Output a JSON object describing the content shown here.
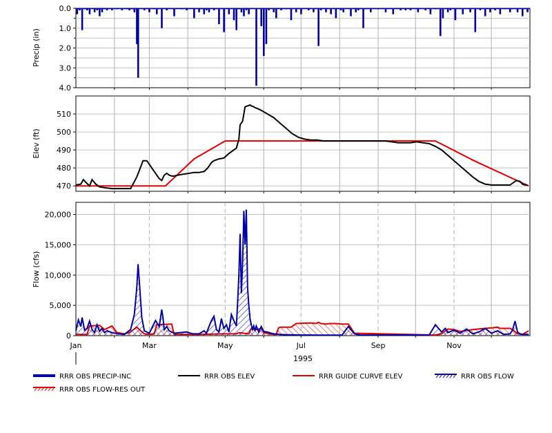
{
  "colors": {
    "precip": "#0000a8",
    "elev": "#000000",
    "guide": "#e00000",
    "flow": "#0000a8",
    "res_out": "#e00000",
    "grid": "#c0c0c0",
    "month_grid": "#b0b0b0"
  },
  "x_axis": {
    "month_labels": [
      "Jan",
      "Mar",
      "May",
      "Jul",
      "Sep",
      "Nov"
    ],
    "year_label": "1995"
  },
  "legend": [
    {
      "key": "precip",
      "label": "RRR OBS PRECIP-INC",
      "style": "thick-line"
    },
    {
      "key": "elev",
      "label": "RRR OBS ELEV",
      "style": "line"
    },
    {
      "key": "guide",
      "label": "RRR GUIDE CURVE ELEV",
      "style": "line"
    },
    {
      "key": "flow",
      "label": "RRR OBS FLOW",
      "style": "hatch"
    },
    {
      "key": "res_out",
      "label": "RRR OBS FLOW-RES OUT",
      "style": "hatch"
    }
  ],
  "chart_data": [
    {
      "type": "bar",
      "inverted_y": true,
      "ylabel": "Precip (in)",
      "ylim": [
        0,
        4
      ],
      "yticks": [
        0,
        1,
        2,
        3,
        4
      ],
      "ytick_labels": [
        "0.0",
        "1.0",
        "2.0",
        "3.0",
        "4.0"
      ],
      "grid": true,
      "x_unit": "day-of-year 1995",
      "series": [
        {
          "name": "RRR OBS PRECIP-INC",
          "x": [
            2,
            4,
            6,
            8,
            10,
            12,
            16,
            18,
            20,
            22,
            24,
            26,
            30,
            34,
            38,
            42,
            44,
            46,
            48,
            50,
            51,
            56,
            60,
            64,
            66,
            70,
            74,
            80,
            86,
            90,
            96,
            100,
            102,
            104,
            106,
            108,
            112,
            116,
            120,
            124,
            128,
            130,
            132,
            134,
            136,
            138,
            140,
            146,
            150,
            152,
            154,
            156,
            160,
            162,
            166,
            170,
            174,
            178,
            182,
            188,
            192,
            196,
            198,
            202,
            206,
            210,
            214,
            216,
            222,
            226,
            228,
            232,
            234,
            238,
            244,
            250,
            256,
            262,
            266,
            270,
            276,
            282,
            286,
            290,
            294,
            296,
            300,
            302,
            306,
            312,
            318,
            322,
            326,
            330,
            334,
            338,
            342,
            346,
            350,
            352,
            356,
            360,
            364
          ],
          "values": [
            0.3,
            0.1,
            1.1,
            0.05,
            0.1,
            0.3,
            0.2,
            0.1,
            0.4,
            0.2,
            0.05,
            0.1,
            0.1,
            0.05,
            0.1,
            0.05,
            0.1,
            0.05,
            0.2,
            1.8,
            3.5,
            0.1,
            0.2,
            0.05,
            0.3,
            1.0,
            0.1,
            0.4,
            0.05,
            0.1,
            0.5,
            0.2,
            0.05,
            0.3,
            0.1,
            0.2,
            0.1,
            0.8,
            1.2,
            0.3,
            0.6,
            1.1,
            0.05,
            0.2,
            0.4,
            0.1,
            0.3,
            3.9,
            0.9,
            2.4,
            1.8,
            0.1,
            0.2,
            0.5,
            0.1,
            0.05,
            0.6,
            0.2,
            0.3,
            0.1,
            0.2,
            1.9,
            0.1,
            0.2,
            0.3,
            0.5,
            0.1,
            0.2,
            0.4,
            0.2,
            0.1,
            1.0,
            0.05,
            0.2,
            0.05,
            0.2,
            0.3,
            0.1,
            0.1,
            0.1,
            0.2,
            0.1,
            0.3,
            0.05,
            1.4,
            0.5,
            0.2,
            0.1,
            0.6,
            0.3,
            0.2,
            1.2,
            0.1,
            0.4,
            0.2,
            0.1,
            0.3,
            0.05,
            0.2,
            0.05,
            0.2,
            0.4,
            0.2
          ]
        }
      ]
    },
    {
      "type": "line",
      "ylabel": "Elev (ft)",
      "ylim": [
        467,
        520
      ],
      "yticks": [
        470,
        480,
        490,
        500,
        510
      ],
      "grid": true,
      "x_unit": "day-of-year 1995",
      "series": [
        {
          "name": "RRR OBS ELEV",
          "x": [
            1,
            5,
            7,
            9,
            12,
            14,
            17,
            20,
            24,
            30,
            35,
            40,
            45,
            50,
            55,
            58,
            60,
            62,
            64,
            66,
            68,
            70,
            72,
            74,
            76,
            78,
            80,
            83,
            87,
            92,
            96,
            100,
            104,
            107,
            110,
            112,
            116,
            120,
            124,
            128,
            130,
            132,
            133,
            135,
            137,
            139,
            141,
            142,
            144,
            145,
            147,
            150,
            155,
            160,
            165,
            170,
            175,
            180,
            185,
            190,
            195,
            200,
            210,
            220,
            230,
            240,
            250,
            255,
            260,
            265,
            270,
            275,
            280,
            285,
            290,
            295,
            300,
            305,
            310,
            315,
            320,
            325,
            330,
            335,
            340,
            345,
            350,
            353,
            355,
            358,
            360,
            362,
            364
          ],
          "values": [
            470.5,
            471,
            473.5,
            472,
            470,
            473.5,
            471,
            469.5,
            469,
            468.5,
            468.5,
            468.5,
            468.5,
            475,
            484,
            484,
            482,
            480,
            478,
            476,
            474,
            473,
            476,
            477,
            476,
            475.5,
            475.5,
            476,
            476.5,
            477,
            477.5,
            477.5,
            478,
            480,
            483,
            484,
            485,
            485.5,
            488,
            490,
            491,
            496,
            504,
            506,
            514,
            514.5,
            515,
            514.5,
            514,
            513.5,
            513,
            512,
            510,
            508,
            505,
            502,
            499,
            497,
            496,
            495.5,
            495.5,
            495,
            495,
            495,
            495,
            495,
            495,
            494.5,
            494,
            494,
            494,
            494.5,
            494,
            493.5,
            492,
            490,
            487,
            484,
            481,
            478,
            475,
            472.5,
            471,
            470.5,
            470.5,
            470.5,
            470.5,
            472,
            473,
            472.5,
            471,
            470.5,
            470.5
          ]
        },
        {
          "name": "RRR GUIDE CURVE ELEV",
          "x": [
            1,
            73,
            96,
            121,
            290,
            321,
            365
          ],
          "values": [
            470,
            470,
            485,
            495,
            495,
            484,
            470
          ]
        }
      ]
    },
    {
      "type": "area",
      "ylabel": "Flow (cfs)",
      "ylim": [
        0,
        22000
      ],
      "yticks": [
        0,
        5000,
        10000,
        15000,
        20000
      ],
      "ytick_labels": [
        "0",
        "5,000",
        "10,000",
        "15,000",
        "20,000"
      ],
      "grid": true,
      "x_unit": "day-of-year 1995",
      "series": [
        {
          "name": "RRR OBS FLOW",
          "x": [
            1,
            3,
            5,
            6,
            8,
            10,
            12,
            14,
            16,
            18,
            20,
            22,
            24,
            26,
            30,
            35,
            40,
            45,
            48,
            50,
            51,
            52,
            54,
            56,
            60,
            65,
            68,
            70,
            71,
            72,
            74,
            76,
            80,
            85,
            90,
            95,
            100,
            104,
            106,
            108,
            110,
            112,
            114,
            116,
            118,
            120,
            122,
            124,
            126,
            128,
            130,
            131,
            132,
            133,
            134,
            135,
            136,
            137,
            138,
            139,
            140,
            141,
            142,
            143,
            144,
            145,
            146,
            148,
            150,
            152,
            155,
            158,
            160,
            165,
            170,
            175,
            180,
            185,
            190,
            195,
            200,
            205,
            210,
            215,
            220,
            225,
            230,
            240,
            250,
            260,
            270,
            280,
            285,
            290,
            295,
            298,
            300,
            305,
            310,
            315,
            320,
            325,
            330,
            335,
            340,
            345,
            350,
            352,
            354,
            356,
            358,
            360,
            365
          ],
          "values": [
            800,
            2600,
            1500,
            3000,
            900,
            1200,
            2400,
            1000,
            500,
            1800,
            700,
            1200,
            500,
            800,
            500,
            300,
            200,
            1000,
            3500,
            8000,
            11800,
            9000,
            3000,
            800,
            400,
            2500,
            1500,
            4300,
            3000,
            1000,
            1500,
            800,
            400,
            500,
            600,
            300,
            300,
            800,
            400,
            1500,
            2500,
            3200,
            1000,
            600,
            2800,
            1200,
            1800,
            600,
            3500,
            2500,
            1600,
            5500,
            10000,
            16800,
            7000,
            12000,
            20600,
            15000,
            20800,
            8000,
            5000,
            2800,
            1800,
            1000,
            1600,
            800,
            1600,
            600,
            1500,
            700,
            600,
            400,
            300,
            200,
            150,
            150,
            100,
            100,
            100,
            80,
            80,
            80,
            80,
            100,
            1500,
            300,
            100,
            100,
            100,
            100,
            100,
            100,
            100,
            1800,
            600,
            1200,
            500,
            900,
            400,
            1100,
            300,
            600,
            1200,
            400,
            800,
            200,
            300,
            900,
            2400,
            600,
            300,
            200,
            200
          ]
        },
        {
          "name": "RRR OBS FLOW-RES OUT",
          "x": [
            1,
            10,
            12,
            20,
            24,
            30,
            34,
            40,
            44,
            50,
            52,
            56,
            60,
            64,
            66,
            78,
            80,
            95,
            100,
            120,
            130,
            132,
            140,
            142,
            146,
            150,
            152,
            156,
            160,
            162,
            164,
            166,
            170,
            174,
            178,
            190,
            194,
            196,
            198,
            202,
            205,
            210,
            215,
            220,
            225,
            290,
            295,
            300,
            305,
            310,
            320,
            330,
            336,
            340,
            342,
            350,
            352,
            356,
            360,
            365
          ],
          "values": [
            200,
            200,
            1600,
            1700,
            1000,
            1600,
            500,
            300,
            500,
            1400,
            1000,
            300,
            200,
            300,
            1800,
            1900,
            200,
            200,
            200,
            300,
            300,
            500,
            300,
            1200,
            1000,
            1200,
            500,
            300,
            200,
            200,
            1300,
            1400,
            1400,
            1400,
            2000,
            2100,
            2000,
            2200,
            2000,
            1900,
            2000,
            2000,
            1900,
            1900,
            400,
            100,
            300,
            1100,
            1000,
            700,
            1000,
            1200,
            1300,
            1400,
            1200,
            1200,
            1000,
            300,
            200,
            800
          ]
        }
      ]
    }
  ]
}
